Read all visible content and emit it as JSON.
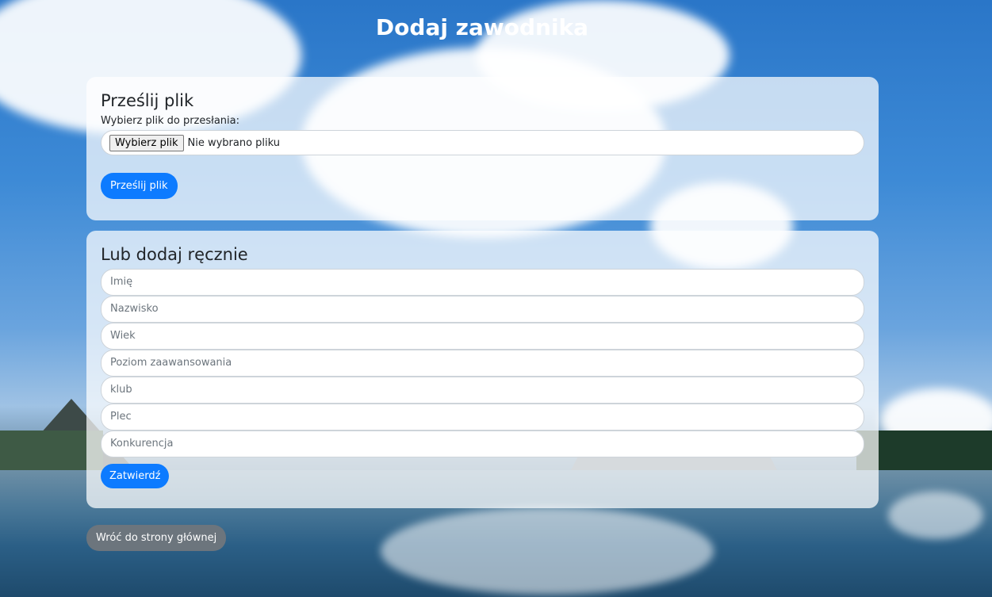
{
  "page": {
    "title": "Dodaj zawodnika"
  },
  "upload": {
    "heading": "Prześlij plik",
    "label": "Wybierz plik do przesłania:",
    "choose_button": "Wybierz plik",
    "status": "Nie wybrano pliku",
    "submit": "Prześlij plik"
  },
  "manual": {
    "heading": "Lub dodaj ręcznie",
    "fields": [
      {
        "placeholder": "Imię"
      },
      {
        "placeholder": "Nazwisko"
      },
      {
        "placeholder": "Wiek"
      },
      {
        "placeholder": "Poziom zaawansowania"
      },
      {
        "placeholder": "klub"
      },
      {
        "placeholder": "Plec"
      },
      {
        "placeholder": "Konkurencja"
      }
    ],
    "submit": "Zatwierdź"
  },
  "back_button": "Wróć do strony głównej",
  "colors": {
    "primary": "#0d7bff",
    "secondary": "#6c757d"
  }
}
